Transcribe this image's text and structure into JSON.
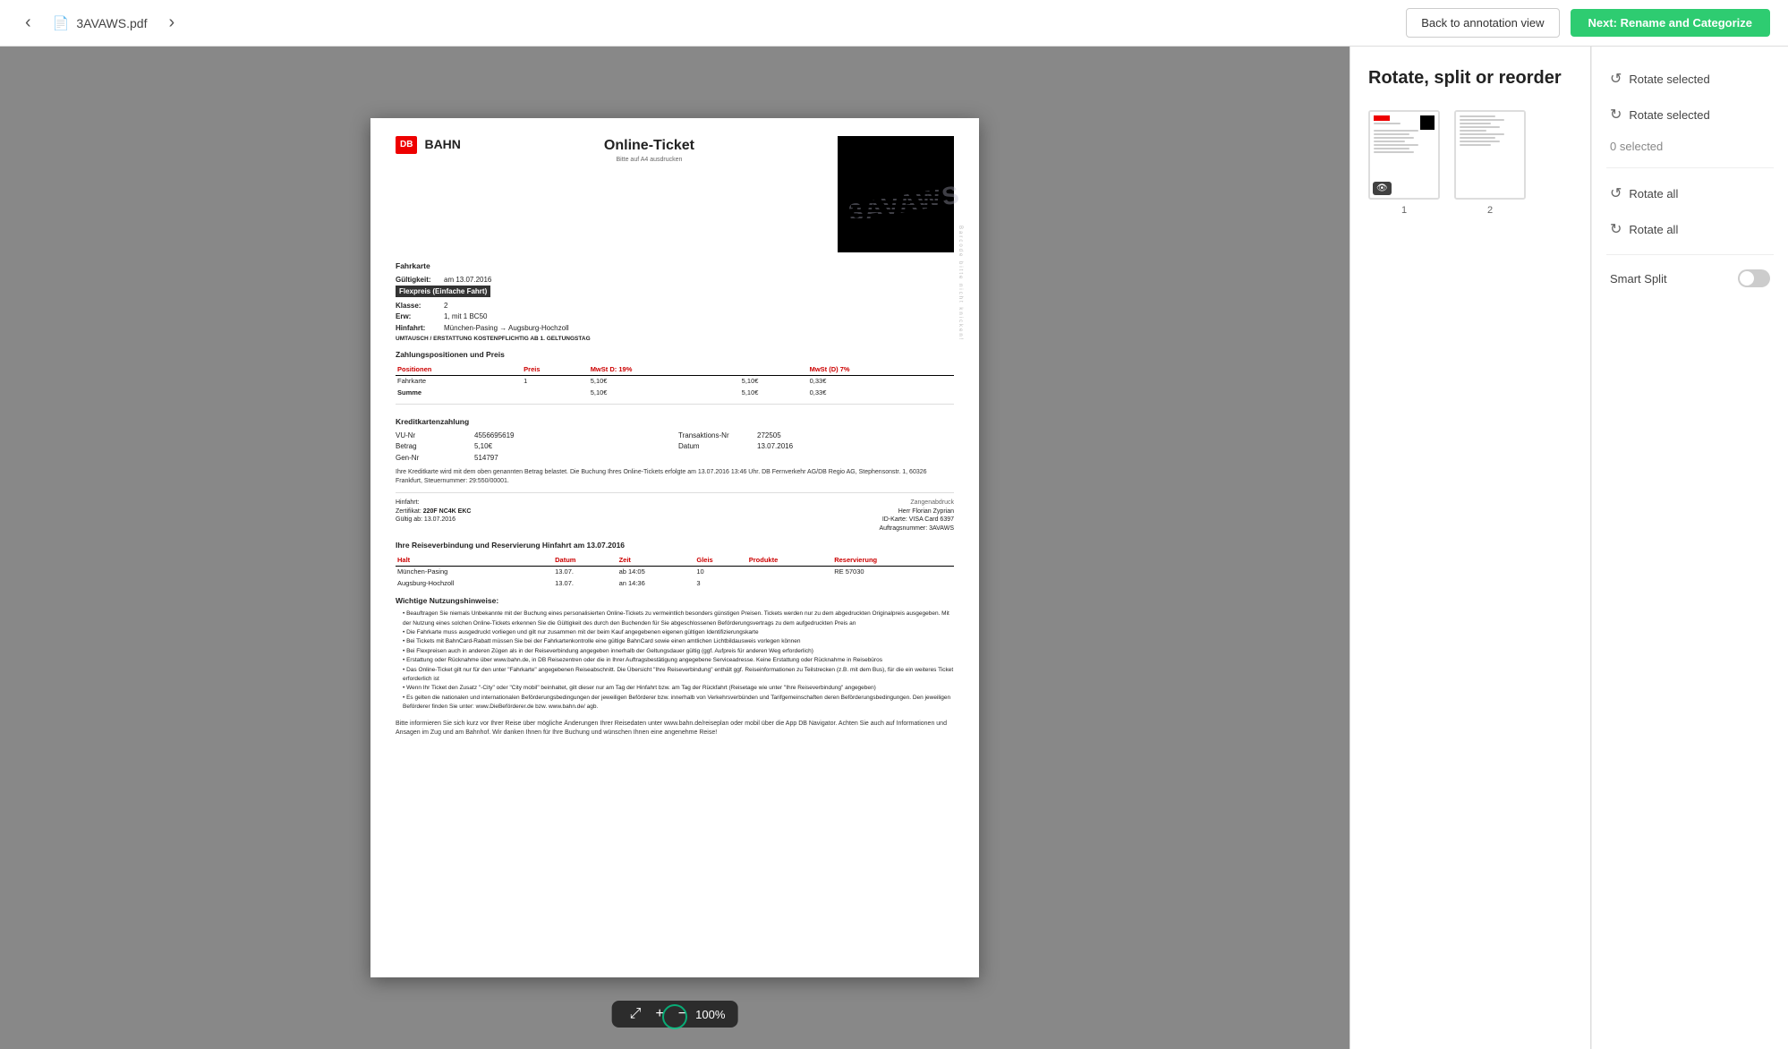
{
  "topbar": {
    "nav_prev_label": "‹",
    "nav_next_label": "›",
    "filename": "3AVAWS.pdf",
    "pdf_icon": "📄",
    "back_button_label": "Back to annotation view",
    "next_button_label": "Next: Rename and Categorize"
  },
  "right_panel": {
    "title": "Rotate, split or reorder",
    "thumbnails": [
      {
        "number": "1",
        "has_eye": true
      },
      {
        "number": "2",
        "has_eye": false
      }
    ],
    "rotate_ccw_selected_label": "Rotate selected",
    "rotate_cw_selected_label": "Rotate selected",
    "selected_count_label": "0 selected",
    "rotate_all_ccw_label": "Rotate all",
    "rotate_all_cw_label": "Rotate all",
    "smart_split_label": "Smart Split"
  },
  "zoom_toolbar": {
    "expand_icon": "⤢",
    "plus_icon": "+",
    "minus_icon": "−",
    "zoom_level": "100%"
  },
  "document": {
    "db_label": "DB",
    "bahn_label": "BAHN",
    "online_ticket_label": "Online-Ticket",
    "bitte_label": "Bitte auf A4 ausdrucken",
    "barcode_side": "Barcode bitte nicht knicken!",
    "fahrkarte_title": "Fahrkarte",
    "gueltigkeit_label": "Gültigkeit:",
    "gueltigkeit_value": "am 13.07.2016",
    "flexpreis_label": "Flexpreis (Einfache Fahrt)",
    "klasse_label": "Klasse:",
    "klasse_value": "2",
    "erw_label": "Erw:",
    "erw_value": "1, mit 1 BC50",
    "hinfahrt_label": "Hinfahrt:",
    "hinfahrt_value": "München-Pasing → Augsburg-Hochzoll",
    "umtausch_text": "UMTAUSCH / ERSTATTUNG KOSTENPFLICHTIG AB 1. GELTUNGSTAG",
    "zahlungspos_title": "Zahlungspositionen und Preis",
    "table_headers": [
      "Positionen",
      "Preis",
      "MwSt D: 19%",
      "MwSt (D) 7%"
    ],
    "table_rows": [
      [
        "Fahrkarte",
        "1",
        "5,10€",
        "5,10€",
        "0,33€"
      ],
      [
        "Summe",
        "",
        "5,10€",
        "5,10€",
        "0,33€"
      ]
    ],
    "kreditkarte_title": "Kreditkartenzahlung",
    "vnu_label": "VU-Nr",
    "vnu_value": "4556695619",
    "transaktions_label": "Transaktions-Nr",
    "transaktions_value": "272505",
    "betrag_label": "Betrag",
    "betrag_value": "5,10€",
    "datum_label": "Datum",
    "datum_value": "13.07.2016",
    "gen_nr_label": "Gen-Nr",
    "gen_nr_value": "514797",
    "kreditkarte_text": "Ihre Kreditkarte wird mit dem oben genannten Betrag belastet. Die Buchung Ihres Online-Tickets erfolgte am 13.07.2016 13:46 Uhr. DB Fernverkehr AG/DB Regio AG, Stephensonstr. 1, 60326 Frankfurt, Steuernummer: 29:550/00001.",
    "reiseverbindung_title": "Ihre Reiseverbindung und Reservierung Hinfahrt am 13.07.2016",
    "table2_headers": [
      "Halt",
      "Datum",
      "Zeit",
      "Gleis",
      "Produkte",
      "Reservierung"
    ],
    "table2_rows": [
      [
        "München-Pasing",
        "13.07.",
        "ab 14:05",
        "10",
        "",
        "RE 57030"
      ],
      [
        "Augsburg-Hochzoll",
        "13.07.",
        "an 14:36",
        "3",
        "",
        ""
      ]
    ],
    "nutzungshinweise_title": "Wichtige Nutzungshinweise:",
    "bullets": [
      "Beauftragen Sie niemals Unbekannte mit der Buchung eines personalisierten Online-Tickets zu vermeintlich besonders günstigen Preisen. Tickets werden nur zu dem abgedruckten Originalpreis ausgegeben. Mit der Nutzung eines solchen Online-Tickets erkennen Sie die Gültigkeit des durch den Buchenden für Sie abgeschlossenen Beförderungsvertrags zu dem aufgedruckten Preis an",
      "Die Fahrkarte muss ausgedruckt vorliegen und gilt nur zusammen mit der beim Kauf angegebenen eigenen gültigen Identifizierungskarte",
      "Bei Tickets mit BahnCard-Rabatt müssen Sie bei der Fahrkartenkontrolle eine gültige BahnCard sowie einen amtlichen Lichtbildausweis vorlegen können",
      "Bei Flexpreisen auch in anderen Zügen als in der Reiseverbindung angegeben innerhalb der Geltungsdauer gültig (ggf. Aufpreis für anderen Weg erforderlich)",
      "Erstattung oder Rücknahme über www.bahn.de, in DB Reisezentren oder die in Ihrer Auftragsbestätigung angegebene Serviceadresse. Keine Erstattung oder Rücknahme in Reisebüros",
      "Das Online-Ticket gilt nur für den unter 'Fahrkarte' angegebenen Reiseabschnitt. Die Übersicht 'Ihre Reiseverbindung' enthält ggf. Reiseinformationen zu Teilstrecken (z.B. mit dem Bus), für die ein weiteres Ticket erforderlich ist",
      "Wenn Ihr Ticket den Zusatz '-City' oder 'City mobil' beinhaltet, gilt dieser nur am Tag der Hinfahrt bzw. am Tag der Rückfahrt (Reisetage wie unter 'Ihre Reiseverbindung' angegeben)",
      "Es gelten die nationalen und internationalen Beförderungsbedingungen der jeweiligen Beförderer bzw. innerhalb von Verkehrsverbünden und Tarifgemeinschaften deren Beförderungsbedingungen. Den jeweiligen Beförderer finden Sie unter: www.DieBeförderer.de bzw. www.bahn.de/ agb."
    ],
    "footer_text": "Bitte informieren Sie sich kurz vor Ihrer Reise über mögliche Änderungen Ihrer Reisedaten unter www.bahn.de/reiseplan oder mobil über die App DB Navigator. Achten Sie auch auf Informationen und Ansagen im Zug und am Bahnhof. Wir danken Ihnen für Ihre Buchung und wünschen Ihnen eine angenehme Reise!",
    "cert_hinfahrt": "Hinfahrt:",
    "cert_zertifikat": "Zertifikat:",
    "cert_zertifikat_value": "220F NC4K EKC",
    "cert_gueltig": "Gültig ab:",
    "cert_gueltig_value": "13.07.2016",
    "watermark": "3AVAWS",
    "person_label": "Herr Florian Zyprian",
    "id_label": "ID-Karte:",
    "id_value": "VISA Card 6397",
    "auftrag_label": "Auftragsnummer:",
    "auftrag_value": "3AVAWS",
    "zangenabdruck": "Zangenabdruck"
  }
}
